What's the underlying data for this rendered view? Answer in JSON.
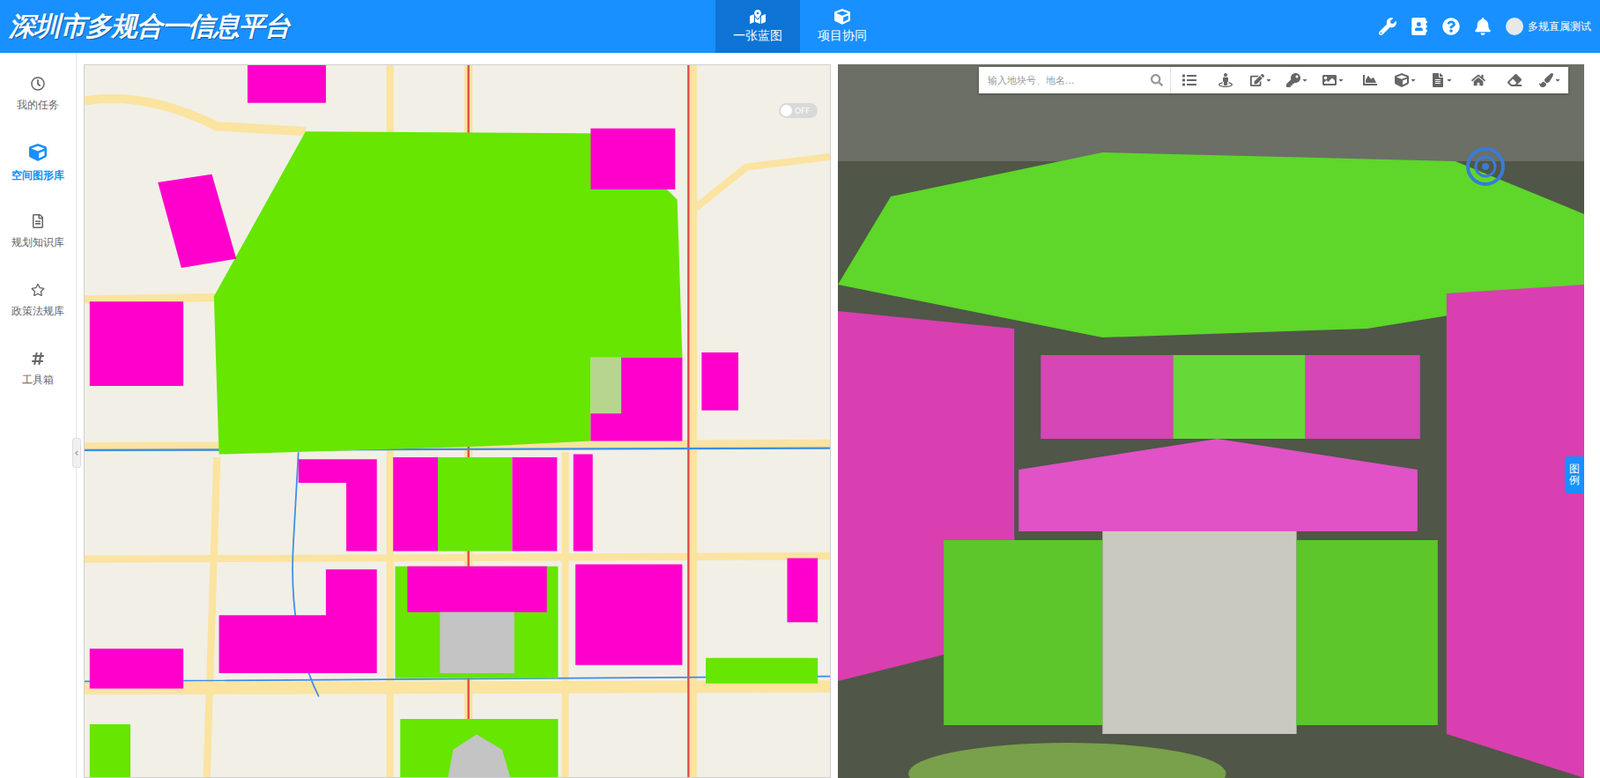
{
  "header": {
    "title": "深圳市多规合一信息平台",
    "tabs": [
      {
        "label": "一张蓝图",
        "selected": true
      },
      {
        "label": "项目协同",
        "selected": false
      }
    ],
    "user": "多规直属测试"
  },
  "sidebar": {
    "items": [
      {
        "label": "我的任务",
        "selected": false
      },
      {
        "label": "空间图形库",
        "selected": true
      },
      {
        "label": "规划知识库",
        "selected": false
      },
      {
        "label": "政策法规库",
        "selected": false
      },
      {
        "label": "工具箱",
        "selected": false
      }
    ],
    "collapse": "‹"
  },
  "map2d": {
    "toggle": {
      "label": "OFF",
      "on": false
    },
    "parcels": [
      {
        "color": "#66e600"
      },
      {
        "color": "#ff00cc"
      },
      {
        "color": "#ff00cc"
      },
      {
        "color": "#ff00cc"
      },
      {
        "color": "#ff00cc"
      },
      {
        "color": "#b8d58f"
      },
      {
        "color": "#ff00cc"
      },
      {
        "color": "#ff00cc"
      },
      {
        "color": "#ff00cc"
      },
      {
        "color": "#ff00cc"
      },
      {
        "color": "#66e600"
      },
      {
        "color": "#ff00cc"
      },
      {
        "color": "#ff00cc"
      },
      {
        "color": "#ff00cc"
      },
      {
        "color": "#66e600"
      },
      {
        "color": "#ff00cc"
      },
      {
        "color": "#c4c4c4"
      },
      {
        "color": "#ff00cc"
      },
      {
        "color": "#ff00cc"
      },
      {
        "color": "#ff00cc"
      },
      {
        "color": "#66e600"
      },
      {
        "color": "#66e600"
      },
      {
        "color": "#66e600"
      },
      {
        "color": "#c4c4c4"
      }
    ]
  },
  "map3d": {
    "search": {
      "placeholder": "输入地块号、地名..."
    },
    "legend": "图例"
  }
}
